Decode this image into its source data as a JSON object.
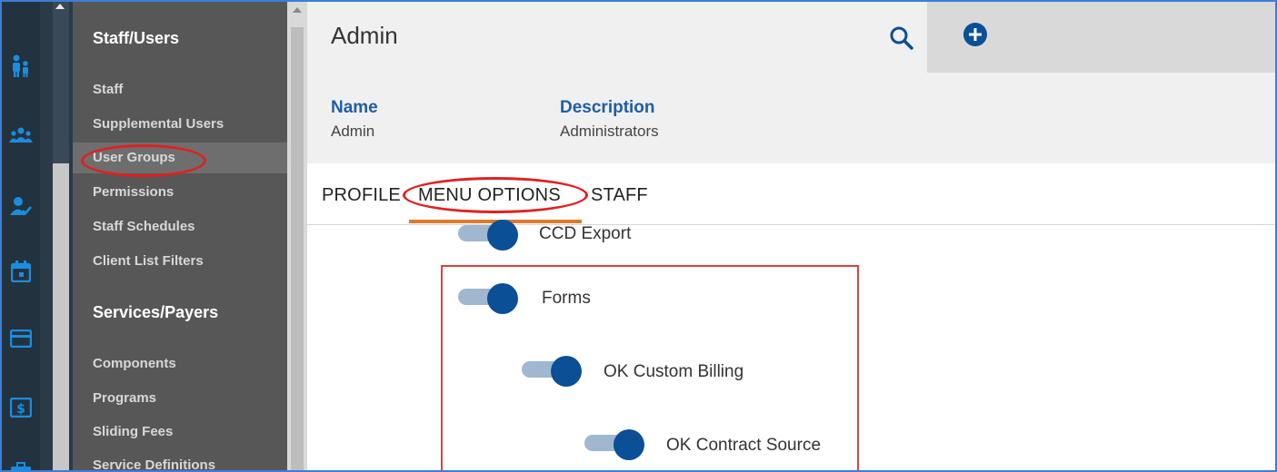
{
  "rail": {
    "icons": [
      "family-icon",
      "group-icon",
      "user-check-icon",
      "calendar-icon",
      "card-icon",
      "billing-icon",
      "briefcase-icon"
    ]
  },
  "menu": {
    "sections": [
      {
        "title": "Staff/Users",
        "items": [
          "Staff",
          "Supplemental Users",
          "User Groups",
          "Permissions",
          "Staff Schedules",
          "Client List Filters"
        ]
      },
      {
        "title": "Services/Payers",
        "items": [
          "Components",
          "Programs",
          "Sliding Fees",
          "Service Definitions"
        ]
      }
    ],
    "active_item": "User Groups"
  },
  "header": {
    "title": "Admin",
    "name_label": "Name",
    "name_value": "Admin",
    "description_label": "Description",
    "description_value": "Administrators"
  },
  "tabs": [
    "PROFILE",
    "MENU OPTIONS",
    "STAFF"
  ],
  "active_tab": "MENU OPTIONS",
  "menu_options": [
    {
      "label": "CCD Export",
      "enabled": true
    },
    {
      "label": "Forms",
      "enabled": true
    },
    {
      "label": "OK Custom Billing",
      "enabled": true
    },
    {
      "label": "OK Contract Source",
      "enabled": true
    }
  ],
  "colors": {
    "accent_blue": "#0b4f96",
    "tab_underline": "#e07a2e",
    "annotation_red": "#e02020",
    "rail_bg": "#23323f",
    "menu_bg": "#575757"
  }
}
